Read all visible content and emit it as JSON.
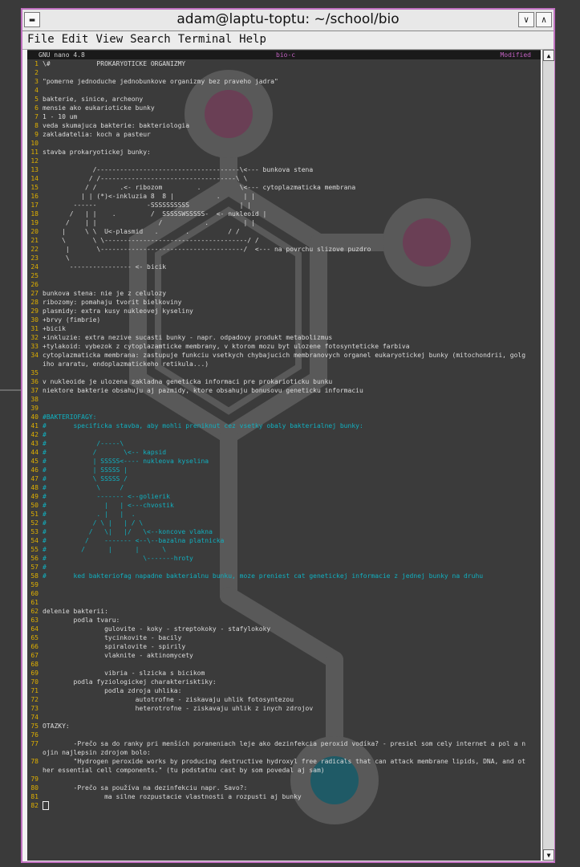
{
  "window": {
    "title": "adam@laptu-toptu: ~/school/bio",
    "minimize_icon": "chevron-down-icon",
    "maximize_icon": "chevron-up-icon"
  },
  "menu": [
    "File",
    "Edit",
    "View",
    "Search",
    "Terminal",
    "Help"
  ],
  "nano": {
    "version": "GNU nano 4.8",
    "filename": "bio-c",
    "status": "Modified"
  },
  "colors": {
    "cyan_comment": "#10b0c0",
    "line_number": "#e0b000",
    "status_magenta": "#c060c0"
  },
  "lines": [
    {
      "n": "1",
      "t": "\\#            PROKARYOTICKE ORGANIZMY"
    },
    {
      "n": "2",
      "t": ""
    },
    {
      "n": "3",
      "t": "\"pomerne jednoduche jednobunkove organizmy bez praveho jadra\""
    },
    {
      "n": "4",
      "t": ""
    },
    {
      "n": "5",
      "t": "bakterie, sinice, archeony"
    },
    {
      "n": "6",
      "t": "mensie ako eukarioticke bunky"
    },
    {
      "n": "7",
      "t": "1 - 10 um"
    },
    {
      "n": "8",
      "t": "veda skumajuca bakterie: bakteriologia"
    },
    {
      "n": "9",
      "t": "zakladatelia: koch a pasteur"
    },
    {
      "n": "10",
      "t": ""
    },
    {
      "n": "11",
      "t": "stavba prokaryotickej bunky:"
    },
    {
      "n": "12",
      "t": ""
    },
    {
      "n": "13",
      "t": "             /-------------------------------------\\<--- bunkova stena"
    },
    {
      "n": "14",
      "t": "            / /-----------------------------------\\ \\"
    },
    {
      "n": "15",
      "t": "           / /      .<- ribozom         .          \\<--- cytoplazmaticka membrana"
    },
    {
      "n": "16",
      "t": "          | | (*)<-inkluzia 8  8 |           .      | |"
    },
    {
      "n": "17",
      "t": "        ------             -SSSSSSSSSS             | |"
    },
    {
      "n": "18",
      "t": "       /   | |    .         /  SSSSSWSSSSS-  <- nukleoid |"
    },
    {
      "n": "19",
      "t": "      /    | |                /           .         | |"
    },
    {
      "n": "20",
      "t": "     |     \\ \\  U<-plasmid   .       .          / /"
    },
    {
      "n": "21",
      "t": "     \\       \\ \\-------------------------------------/ /"
    },
    {
      "n": "22",
      "t": "      |       \\-------------------------------------/  <--- na povrchu slizove puzdro"
    },
    {
      "n": "23",
      "t": "      \\"
    },
    {
      "n": "24",
      "t": "       ---------------- <- bicik"
    },
    {
      "n": "25",
      "t": ""
    },
    {
      "n": "26",
      "t": ""
    },
    {
      "n": "27",
      "t": "bunkova stena: nie je z celulozy"
    },
    {
      "n": "28",
      "t": "ribozomy: pomahaju tvorit bielkoviny"
    },
    {
      "n": "29",
      "t": "plasmidy: extra kusy nukleovej kyseliny"
    },
    {
      "n": "30",
      "t": "+brvy (fimbrie)"
    },
    {
      "n": "31",
      "t": "+bicik"
    },
    {
      "n": "32",
      "t": "+inkluzie: extra nezive sucasti bunky - napr. odpadovy produkt metabolizmus"
    },
    {
      "n": "33",
      "t": "+tylakoid: vybezok z cytoplazamticke membrany, v ktorom mozu byt ulozene fotosynteticke farbiva"
    },
    {
      "n": "34",
      "t": "cytoplazmaticka membrana: zastupuje funkciu vsetkych chybajucich membranovych organel eukaryotickej bunky (mitochondrii, golg"
    },
    {
      "n": "",
      "t": "iho araratu, endoplazmatickeho retikula...)"
    },
    {
      "n": "35",
      "t": ""
    },
    {
      "n": "36",
      "t": "v nukleoide je ulozena zakladna geneticka informaci pre prokarioticku bunku"
    },
    {
      "n": "37",
      "t": "niektore bakterie obsahuju aj pazmidy, ktore obsahuju bonusovu geneticku informaciu"
    },
    {
      "n": "38",
      "t": ""
    },
    {
      "n": "39",
      "t": ""
    },
    {
      "n": "40",
      "t": "#BAKTERIOFAGY:",
      "c": true
    },
    {
      "n": "41",
      "t": "#       specificka stavba, aby mohli preniknut cez vsetky obaly bakterialnej bunky:",
      "c": true
    },
    {
      "n": "42",
      "t": "#",
      "c": true
    },
    {
      "n": "43",
      "t": "#             /-----\\",
      "c": true
    },
    {
      "n": "44",
      "t": "#            /       \\<-- kapsid",
      "c": true
    },
    {
      "n": "45",
      "t": "#            | SSSSS<---- nukleova kyselina",
      "c": true
    },
    {
      "n": "46",
      "t": "#            | SSSSS |",
      "c": true
    },
    {
      "n": "47",
      "t": "#            \\ SSSSS /",
      "c": true
    },
    {
      "n": "48",
      "t": "#             \\     /",
      "c": true
    },
    {
      "n": "49",
      "t": "#             ------- <--golierik",
      "c": true
    },
    {
      "n": "50",
      "t": "#               |   | <---chvostik",
      "c": true
    },
    {
      "n": "51",
      "t": "#             . |   |  .",
      "c": true
    },
    {
      "n": "52",
      "t": "#            / \\ |   | / \\",
      "c": true
    },
    {
      "n": "53",
      "t": "#           /   \\|   |/   \\<--koncove vlakna",
      "c": true
    },
    {
      "n": "54",
      "t": "#          /    ------- <--\\--bazalna platnicka",
      "c": true
    },
    {
      "n": "55",
      "t": "#         /      |      |      \\",
      "c": true
    },
    {
      "n": "56",
      "t": "#                         \\-------hroty",
      "c": true
    },
    {
      "n": "57",
      "t": "#",
      "c": true
    },
    {
      "n": "58",
      "t": "#       ked bakteriofag napadne bakterialnu bunku, moze preniest cat genetickej informacie z jednej bunky na druhu",
      "c": true
    },
    {
      "n": "59",
      "t": ""
    },
    {
      "n": "60",
      "t": ""
    },
    {
      "n": "61",
      "t": ""
    },
    {
      "n": "62",
      "t": "delenie bakterii:"
    },
    {
      "n": "63",
      "t": "        podla tvaru:"
    },
    {
      "n": "64",
      "t": "                gulovite - koky - streptokoky - stafylokoky"
    },
    {
      "n": "65",
      "t": "                tycinkovite - bacily"
    },
    {
      "n": "66",
      "t": "                spiralovite - spirily"
    },
    {
      "n": "67",
      "t": "                vlaknite - aktinomycety"
    },
    {
      "n": "68",
      "t": ""
    },
    {
      "n": "69",
      "t": "                vibria - slzicka s bicikom"
    },
    {
      "n": "70",
      "t": "        podla fyziologickej charakterisktiky:"
    },
    {
      "n": "71",
      "t": "                podla zdroja uhlika:"
    },
    {
      "n": "72",
      "t": "                        autotrofne - ziskavaju uhlik fotosyntezou"
    },
    {
      "n": "73",
      "t": "                        heterotrofne - ziskavaju uhlik z inych zdrojov"
    },
    {
      "n": "74",
      "t": ""
    },
    {
      "n": "75",
      "t": "OTAZKY:"
    },
    {
      "n": "76",
      "t": ""
    },
    {
      "n": "77",
      "t": "        -Prečo sa do ranky pri menších poraneniach leje ako dezinfekcia peroxid vodíka? - presiel som cely internet a pol a n"
    },
    {
      "n": "",
      "t": "ojin najlepsin zdrojom bolo:"
    },
    {
      "n": "78",
      "t": "        \"Hydrogen peroxide works by producing destructive hydroxyl free radicals that can attack membrane lipids, DNA, and ot"
    },
    {
      "n": "",
      "t": "her essential cell components.\" (tu podstatnu cast by som povedal aj sam)"
    },
    {
      "n": "79",
      "t": ""
    },
    {
      "n": "80",
      "t": "        -Prečo sa používa na dezinfekciu napr. Savo?:"
    },
    {
      "n": "81",
      "t": "                ma silne rozpustacie vlastnosti a rozpusti aj bunky"
    },
    {
      "n": "82",
      "t": "",
      "cursor": true
    }
  ],
  "scrollbar": {
    "up_icon": "arrow-up-icon",
    "down_icon": "arrow-down-icon"
  }
}
